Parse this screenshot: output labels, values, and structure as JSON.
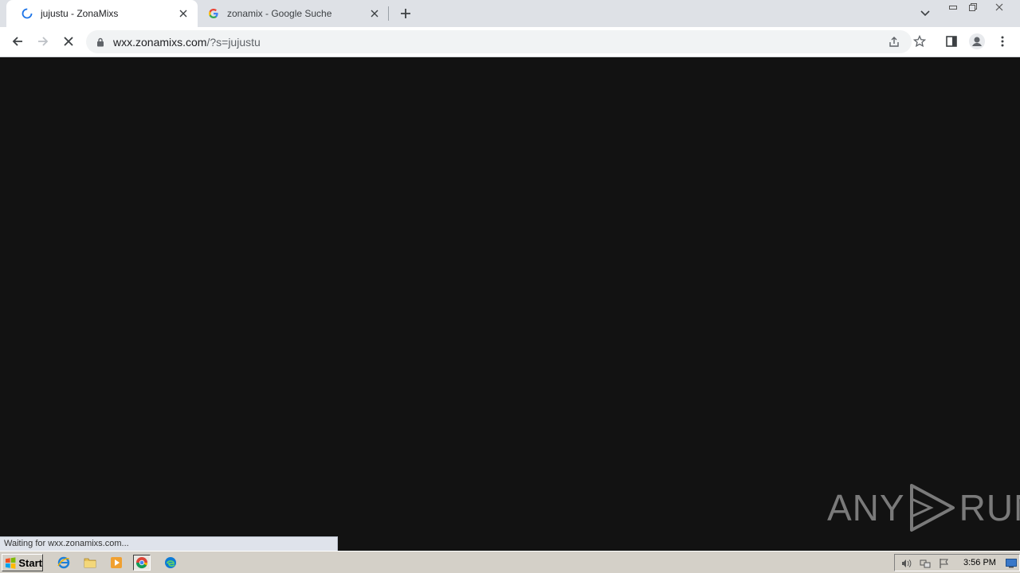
{
  "browser": {
    "tabs": [
      {
        "title": "jujustu - ZonaMixs",
        "favicon": "loading-spinner-icon",
        "active": true
      },
      {
        "title": "zonamix - Google Suche",
        "favicon": "google-icon",
        "active": false
      }
    ],
    "address_bar": {
      "url_host": "wxx.zonamixs.com",
      "url_rest": "/?s=jujustu"
    },
    "status_text": "Waiting for wxx.zonamixs.com..."
  },
  "watermark": {
    "left": "ANY",
    "right": "RUN"
  },
  "taskbar": {
    "start_label": "Start",
    "clock": "3:56 PM"
  },
  "colors": {
    "page_background": "#121212",
    "tabstrip": "#dee1e6",
    "taskbar": "#d4d0c8",
    "accent_blue": "#1a73e8"
  }
}
